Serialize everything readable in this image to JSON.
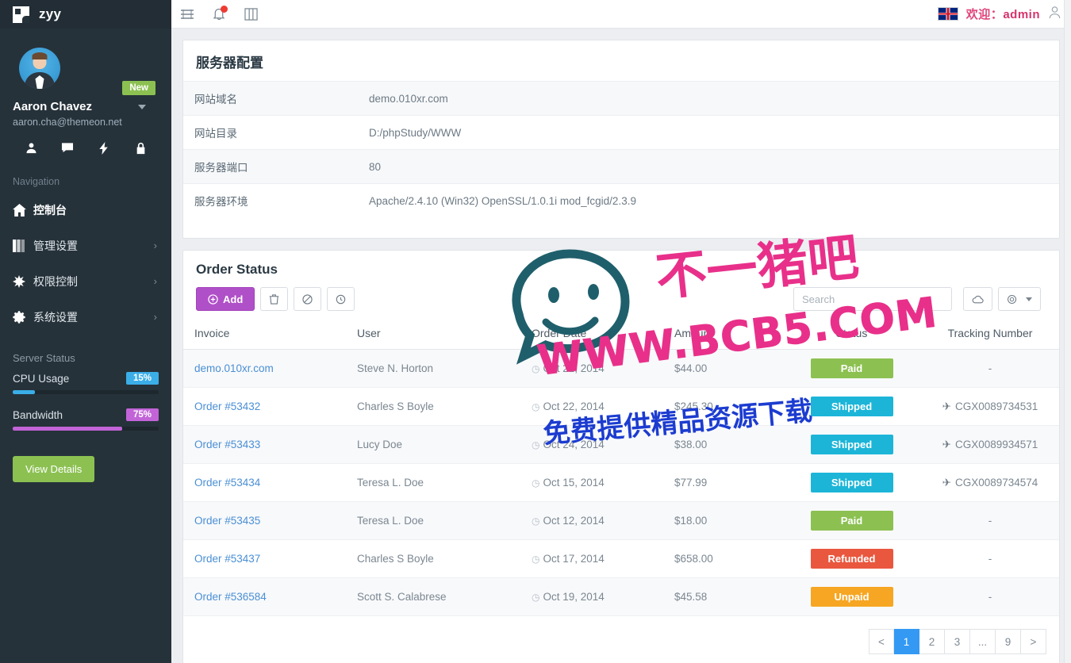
{
  "sidebar": {
    "brand": {
      "name": "zyy",
      "logo_icon": "flag-logo-icon"
    },
    "profile": {
      "name": "Aaron Chavez",
      "email": "aaron.cha@themeon.net",
      "badge": "New",
      "quick_icons": [
        "user-icon",
        "chat-icon",
        "bolt-icon",
        "lock-icon"
      ]
    },
    "nav_title": "Navigation",
    "items": [
      {
        "label": "控制台",
        "icon": "home-icon",
        "chevron": "",
        "active": true
      },
      {
        "label": "管理设置",
        "icon": "book-icon",
        "chevron": "›",
        "active": false
      },
      {
        "label": "权限控制",
        "icon": "asterisk-icon",
        "chevron": "›",
        "active": false
      },
      {
        "label": "系统设置",
        "icon": "gear-icon",
        "chevron": "›",
        "active": false
      }
    ],
    "server_status": {
      "title": "Server Status",
      "metrics": [
        {
          "label": "CPU Usage",
          "value": "15%",
          "percent": 15,
          "color": "#3baee8"
        },
        {
          "label": "Bandwidth",
          "value": "75%",
          "percent": 75,
          "color": "#c264d8"
        }
      ],
      "view_details": "View Details"
    }
  },
  "topbar": {
    "buttons": [
      "menu-icon",
      "bell-icon",
      "layout-icon"
    ],
    "language_flag": "uk-flag-icon",
    "welcome_text": "欢迎：",
    "username": "admin",
    "user_icon": "user-outline-icon"
  },
  "server_config": {
    "title": "服务器配置",
    "rows": [
      {
        "key": "网站域名",
        "value": "demo.010xr.com"
      },
      {
        "key": "网站目录",
        "value": "D:/phpStudy/WWW"
      },
      {
        "key": "服务器端口",
        "value": "80"
      },
      {
        "key": "服务器环境",
        "value": "Apache/2.4.10 (Win32) OpenSSL/1.0.1i mod_fcgid/2.3.9"
      }
    ]
  },
  "orders_panel": {
    "title": "Order Status",
    "toolbar": {
      "add_label": "Add",
      "add_icon": "plus-circle-icon",
      "icon_buttons": [
        "trash-icon",
        "ban-icon",
        "refresh-icon"
      ],
      "search_placeholder": "Search",
      "right_icons": [
        "cloud-icon",
        "gear-dropdown-icon"
      ]
    },
    "columns": [
      "Invoice",
      "User",
      "Order Date",
      "Amount",
      "Status",
      "Tracking Number"
    ],
    "rows": [
      {
        "invoice": "demo.010xr.com",
        "user": "Steve N. Horton",
        "date": "Oct 22, 2014",
        "amount": "$44.00",
        "status": "Paid",
        "status_color": "#8cc152",
        "tracking": "-"
      },
      {
        "invoice": "Order #53432",
        "user": "Charles S Boyle",
        "date": "Oct 22, 2014",
        "amount": "$245.30",
        "status": "Shipped",
        "status_color": "#1cb5d8",
        "tracking": "CGX0089734531"
      },
      {
        "invoice": "Order #53433",
        "user": "Lucy Doe",
        "date": "Oct 24, 2014",
        "amount": "$38.00",
        "status": "Shipped",
        "status_color": "#1cb5d8",
        "tracking": "CGX0089934571"
      },
      {
        "invoice": "Order #53434",
        "user": "Teresa L. Doe",
        "date": "Oct 15, 2014",
        "amount": "$77.99",
        "status": "Shipped",
        "status_color": "#1cb5d8",
        "tracking": "CGX0089734574"
      },
      {
        "invoice": "Order #53435",
        "user": "Teresa L. Doe",
        "date": "Oct 12, 2014",
        "amount": "$18.00",
        "status": "Paid",
        "status_color": "#8cc152",
        "tracking": "-"
      },
      {
        "invoice": "Order #53437",
        "user": "Charles S Boyle",
        "date": "Oct 17, 2014",
        "amount": "$658.00",
        "status": "Refunded",
        "status_color": "#e9573f",
        "tracking": "-"
      },
      {
        "invoice": "Order #536584",
        "user": "Scott S. Calabrese",
        "date": "Oct 19, 2014",
        "amount": "$45.58",
        "status": "Unpaid",
        "status_color": "#f6a623",
        "tracking": "-"
      }
    ],
    "pagination": [
      "<",
      "1",
      "2",
      "3",
      "...",
      "9",
      ">"
    ],
    "active_page": "1"
  },
  "watermark": {
    "brand_cn": "不一猪吧",
    "url": "WWW.BCB5.COM",
    "tagline": "免费提供精品资源下载"
  },
  "colors": {
    "sidebar_bg": "#26323a",
    "accent_purple": "#b050c8",
    "accent_blue": "#3399f3",
    "accent_green": "#8cc152"
  }
}
